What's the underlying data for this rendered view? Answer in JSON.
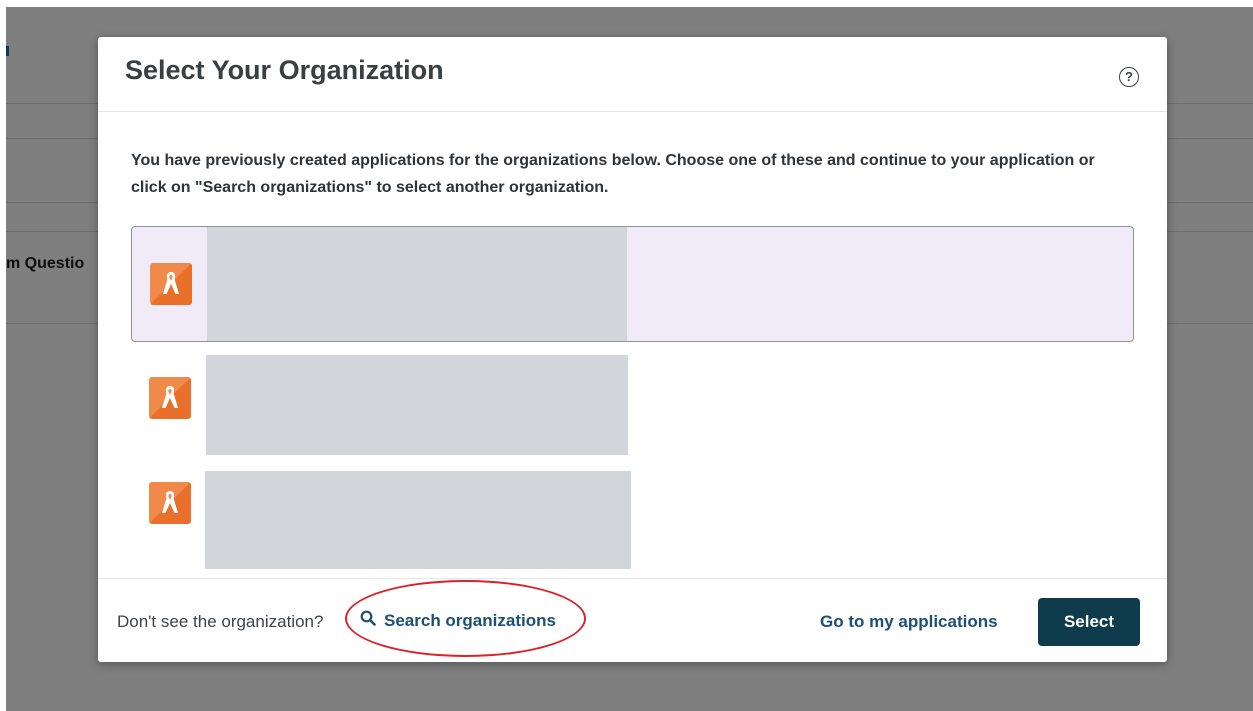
{
  "background": {
    "side_text": "m Questio"
  },
  "modal": {
    "title": "Select Your Organization",
    "help_icon": "?",
    "intro": "You have previously created applications for the organizations below. Choose one of these and continue to your application or click on \"Search organizations\" to select another organization.",
    "organizations": [
      {
        "icon": "ribbon-icon",
        "selected": true
      },
      {
        "icon": "ribbon-icon",
        "selected": false
      },
      {
        "icon": "ribbon-icon",
        "selected": false
      }
    ],
    "footer": {
      "prompt": "Don't see the organization?",
      "search_label": "Search organizations",
      "go_label": "Go to my applications",
      "select_label": "Select"
    }
  },
  "colors": {
    "accent": "#1d4f78",
    "primary_button": "#0f3c4c",
    "org_icon": "#f08a4b",
    "annotation": "#d8232a",
    "selected_row": "#f0ebf7"
  }
}
